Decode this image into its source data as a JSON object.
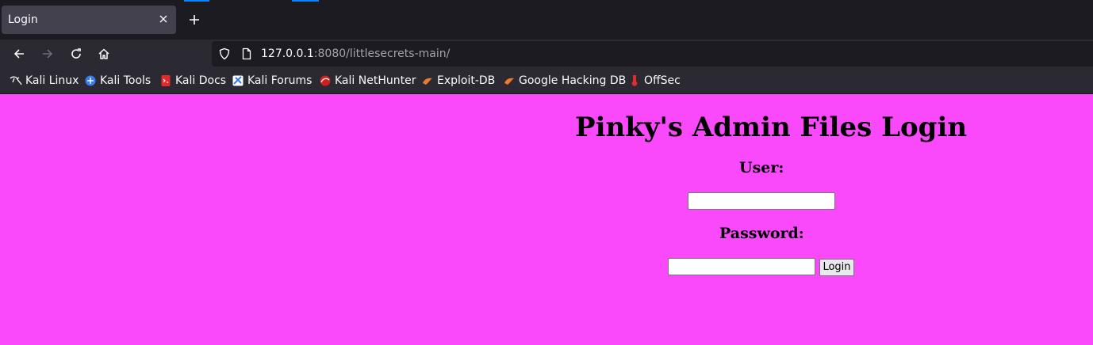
{
  "browser": {
    "tab": {
      "title": "Login",
      "close_icon": "close-icon"
    },
    "new_tab_icon": "plus-icon",
    "nav": {
      "back_icon": "arrow-left-icon",
      "forward_icon": "arrow-right-icon",
      "reload_icon": "reload-icon",
      "home_icon": "home-icon"
    },
    "url": {
      "host": "127.0.0.1",
      "rest": ":8080/littlesecrets-main/"
    },
    "bookmarks": [
      {
        "label": "Kali Linux",
        "icon": "kali-dragon-icon"
      },
      {
        "label": "Kali Tools",
        "icon": "kali-tools-icon"
      },
      {
        "label": "Kali Docs",
        "icon": "kali-docs-icon"
      },
      {
        "label": "Kali Forums",
        "icon": "kali-forums-icon"
      },
      {
        "label": "Kali NetHunter",
        "icon": "kali-nethunter-icon"
      },
      {
        "label": "Exploit-DB",
        "icon": "exploit-db-icon"
      },
      {
        "label": "Google Hacking DB",
        "icon": "ghdb-icon"
      },
      {
        "label": "OffSec",
        "icon": "offsec-icon"
      }
    ]
  },
  "page": {
    "background": "#fa48fb",
    "title": "Pinky's Admin Files Login",
    "user_label": "User:",
    "user_value": "",
    "password_label": "Password:",
    "password_value": "",
    "login_button": "Login"
  }
}
